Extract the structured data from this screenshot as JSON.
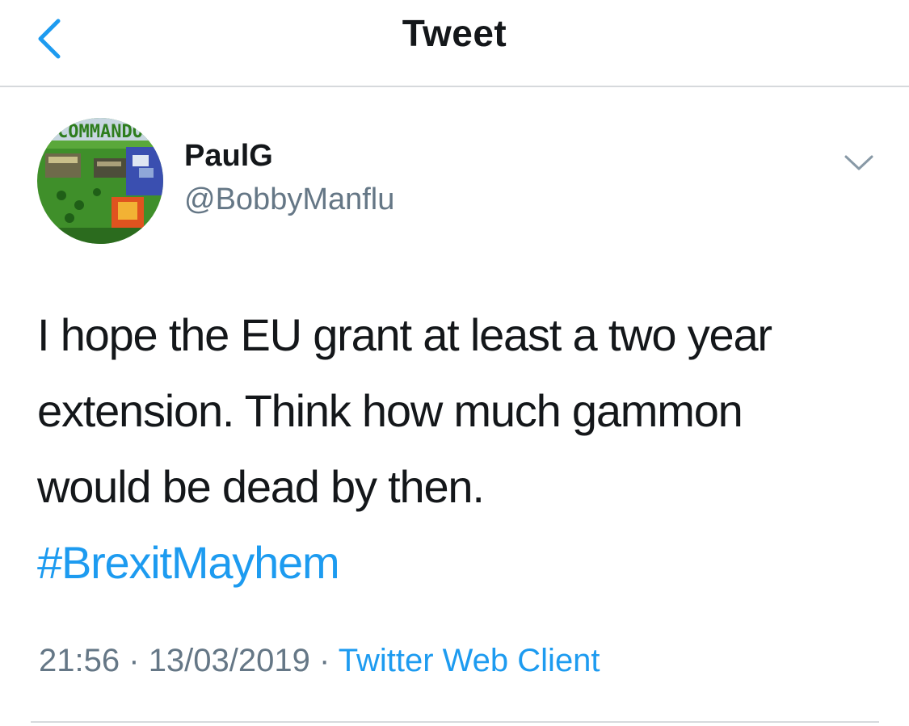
{
  "header": {
    "title": "Tweet",
    "back_icon": "chevron-left-icon"
  },
  "author": {
    "name": "PaulG",
    "handle": "@BobbyManflu",
    "avatar_icon": "avatar-image",
    "avatar_text": "COMMANDO"
  },
  "tweet": {
    "lines": [
      "I hope the EU grant at least a two year",
      "extension. Think how much gammon",
      "would be dead by then."
    ],
    "hashtag": "#BrexitMayhem"
  },
  "meta": {
    "time": "21:56",
    "separator": "·",
    "date": "13/03/2019",
    "source": "Twitter Web Client"
  },
  "colors": {
    "link": "#1d9bf0",
    "secondary_text": "#657786",
    "primary_text": "#14171a",
    "divider": "#d6d9dc"
  }
}
